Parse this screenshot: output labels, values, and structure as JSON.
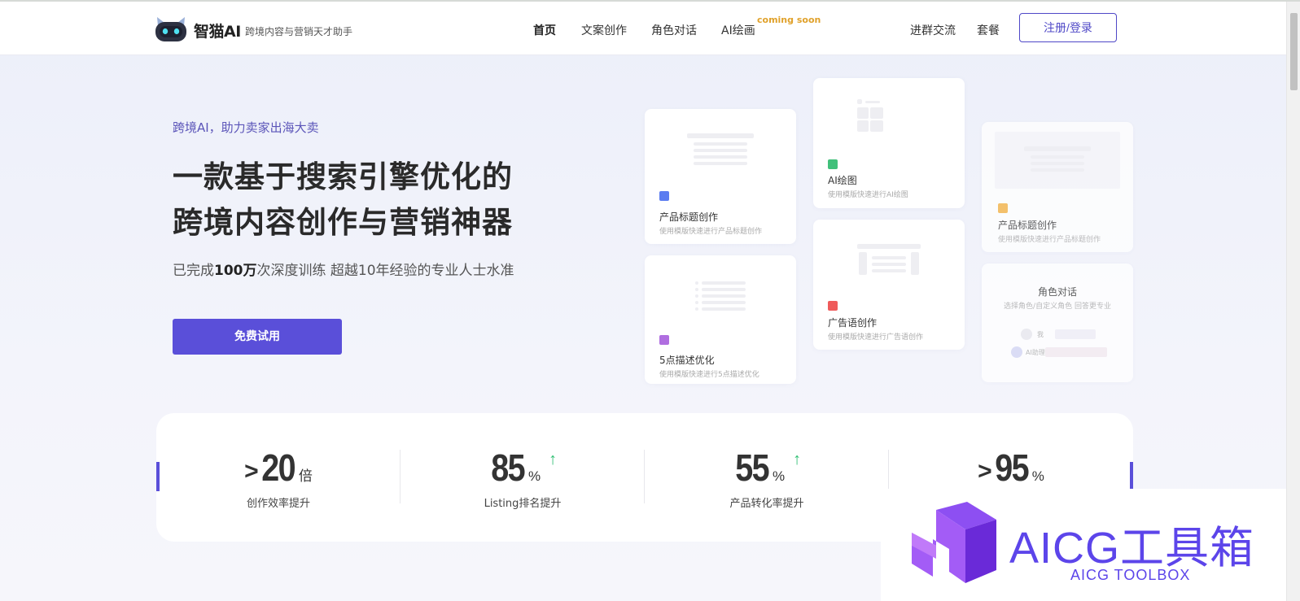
{
  "header": {
    "brand": "智猫AI",
    "slogan": "跨境内容与营销天才助手",
    "nav": [
      {
        "label": "首页"
      },
      {
        "label": "文案创作"
      },
      {
        "label": "角色对话"
      },
      {
        "label": "AI绘画"
      }
    ],
    "coming_soon": "coming soon",
    "right_links": [
      {
        "label": "进群交流"
      },
      {
        "label": "套餐"
      }
    ],
    "login_label": "注册/登录"
  },
  "hero": {
    "kicker": "跨境AI，助力卖家出海大卖",
    "title_line1": "一款基于搜索引擎优化的",
    "title_line2": "跨境内容创作与营销神器",
    "sub_prefix": "已完成",
    "sub_bold": "100万",
    "sub_suffix": "次深度训练 超越10年经验的专业人士水准",
    "cta_label": "免费试用"
  },
  "cards": [
    {
      "title": "产品标题创作",
      "desc": "使用模版快速进行产品标题创作",
      "icon_color": "#5b7cf0"
    },
    {
      "title": "5点描述优化",
      "desc": "使用模版快速进行5点描述优化",
      "icon_color": "#b06ee0"
    },
    {
      "title": "AI绘图",
      "desc": "使用模版快速进行AI绘图",
      "icon_color": "#41c07a"
    },
    {
      "title": "广告语创作",
      "desc": "使用模版快速进行广告语创作",
      "icon_color": "#ef5b5b"
    },
    {
      "title": "产品标题创作",
      "desc": "使用模版快速进行产品标题创作",
      "icon_color": "#f4b243"
    },
    {
      "title": "角色对话",
      "desc": "选择角色/自定义角色 回答更专业",
      "user_label": "我",
      "bot_label": "AI助理"
    }
  ],
  "stats": [
    {
      "prefix": ">",
      "value": "20",
      "unit": "倍",
      "label": "创作效率提升",
      "arrow": ""
    },
    {
      "prefix": "",
      "value": "85",
      "unit": "%",
      "label": "Listing排名提升",
      "arrow": "↑"
    },
    {
      "prefix": "",
      "value": "55",
      "unit": "%",
      "label": "产品转化率提升",
      "arrow": "↑"
    },
    {
      "prefix": ">",
      "value": "95",
      "unit": "%",
      "label": "",
      "arrow": ""
    }
  ],
  "watermark": {
    "title": "AICG工具箱",
    "subtitle": "AICG TOOLBOX"
  },
  "colors": {
    "accent": "#5a4fd9",
    "coming_soon": "#e0a12a",
    "up_arrow": "#2fbf72",
    "watermark": "#5c45ea"
  }
}
